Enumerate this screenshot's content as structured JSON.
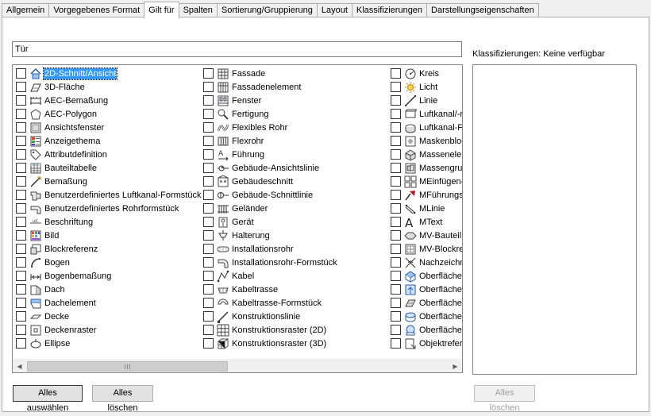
{
  "tabs": [
    {
      "label": "Allgemein",
      "active": false
    },
    {
      "label": "Vorgegebenes Format",
      "active": false
    },
    {
      "label": "Gilt für",
      "active": true
    },
    {
      "label": "Spalten",
      "active": false
    },
    {
      "label": "Sortierung/Gruppierung",
      "active": false
    },
    {
      "label": "Layout",
      "active": false
    },
    {
      "label": "Klassifizierungen",
      "active": false
    },
    {
      "label": "Darstellungseigenschaften",
      "active": false
    }
  ],
  "search": {
    "value": "Tür"
  },
  "columns": [
    [
      {
        "label": "2D-Schnitt/Ansicht",
        "icon": "house-section-icon",
        "selected": true
      },
      {
        "label": "3D-Fläche",
        "icon": "3d-face-icon"
      },
      {
        "label": "AEC-Bemaßung",
        "icon": "aec-dimension-icon"
      },
      {
        "label": "AEC-Polygon",
        "icon": "polygon-icon"
      },
      {
        "label": "Ansichtsfenster",
        "icon": "viewport-icon"
      },
      {
        "label": "Anzeigethema",
        "icon": "display-theme-icon"
      },
      {
        "label": "Attributdefinition",
        "icon": "tag-icon"
      },
      {
        "label": "Bauteiltabelle",
        "icon": "table-icon"
      },
      {
        "label": "Bemaßung",
        "icon": "dimension-icon"
      },
      {
        "label": "Benutzerdefiniertes Luftkanal-Formstück",
        "icon": "duct-fitting-icon"
      },
      {
        "label": "Benutzerdefiniertes Rohrformstück",
        "icon": "pipe-fitting-icon"
      },
      {
        "label": "Beschriftung",
        "icon": "annotation-icon"
      },
      {
        "label": "Bild",
        "icon": "image-icon"
      },
      {
        "label": "Blockreferenz",
        "icon": "block-reference-icon"
      },
      {
        "label": "Bogen",
        "icon": "arc-icon"
      },
      {
        "label": "Bogenbemaßung",
        "icon": "arc-dimension-icon"
      },
      {
        "label": "Dach",
        "icon": "roof-icon"
      },
      {
        "label": "Dachelement",
        "icon": "roof-slab-icon"
      },
      {
        "label": "Decke",
        "icon": "slab-icon"
      },
      {
        "label": "Deckenraster",
        "icon": "ceiling-grid-icon"
      },
      {
        "label": "Ellipse",
        "icon": "ellipse-icon"
      }
    ],
    [
      {
        "label": "Fassade",
        "icon": "curtain-wall-icon"
      },
      {
        "label": "Fassadenelement",
        "icon": "curtain-wall-unit-icon"
      },
      {
        "label": "Fenster",
        "icon": "window-icon"
      },
      {
        "label": "Fertigung",
        "icon": "fabrication-icon"
      },
      {
        "label": "Flexibles Rohr",
        "icon": "flex-pipe-icon"
      },
      {
        "label": "Flexrohr",
        "icon": "flex-duct-icon"
      },
      {
        "label": "Führung",
        "icon": "leader-icon"
      },
      {
        "label": "Gebäude-Ansichtslinie",
        "icon": "elevation-line-icon"
      },
      {
        "label": "Gebäudeschnitt",
        "icon": "building-section-icon"
      },
      {
        "label": "Gebäude-Schnittlinie",
        "icon": "section-line-icon"
      },
      {
        "label": "Geländer",
        "icon": "railing-icon"
      },
      {
        "label": "Gerät",
        "icon": "device-icon"
      },
      {
        "label": "Halterung",
        "icon": "hanger-icon"
      },
      {
        "label": "Installationsrohr",
        "icon": "conduit-icon"
      },
      {
        "label": "Installationsrohr-Formstück",
        "icon": "conduit-fitting-icon"
      },
      {
        "label": "Kabel",
        "icon": "wire-icon"
      },
      {
        "label": "Kabeltrasse",
        "icon": "cable-tray-icon"
      },
      {
        "label": "Kabeltrasse-Formstück",
        "icon": "cable-tray-fitting-icon"
      },
      {
        "label": "Konstruktionslinie",
        "icon": "construction-line-icon"
      },
      {
        "label": "Konstruktionsraster (2D)",
        "icon": "grid-2d-icon"
      },
      {
        "label": "Konstruktionsraster (3D)",
        "icon": "grid-3d-icon"
      }
    ],
    [
      {
        "label": "Kreis",
        "icon": "circle-icon"
      },
      {
        "label": "Licht",
        "icon": "light-icon"
      },
      {
        "label": "Linie",
        "icon": "line-icon"
      },
      {
        "label": "Luftkanal/-r",
        "icon": "duct-icon"
      },
      {
        "label": "Luftkanal-Fo",
        "icon": "duct-fitting-2-icon"
      },
      {
        "label": "Maskenbloc",
        "icon": "mask-block-icon"
      },
      {
        "label": "Massenelem",
        "icon": "mass-element-icon"
      },
      {
        "label": "Massengrup",
        "icon": "mass-group-icon"
      },
      {
        "label": "MEinfügen-",
        "icon": "minsert-icon"
      },
      {
        "label": "MFührungsli",
        "icon": "mleader-icon"
      },
      {
        "label": "MLinie",
        "icon": "mline-icon"
      },
      {
        "label": "MText",
        "icon": "mtext-icon"
      },
      {
        "label": "MV-Bauteil",
        "icon": "mv-part-icon"
      },
      {
        "label": "MV-Blockref",
        "icon": "mv-block-icon"
      },
      {
        "label": "Nachzeichn",
        "icon": "trace-icon"
      },
      {
        "label": "Oberfläche",
        "icon": "surface-icon"
      },
      {
        "label": "Oberfläche",
        "icon": "surface-2-icon"
      },
      {
        "label": "Oberfläche",
        "icon": "surface-3-icon"
      },
      {
        "label": "Oberfläche",
        "icon": "surface-4-icon"
      },
      {
        "label": "Oberfläche",
        "icon": "surface-5-icon"
      },
      {
        "label": "Objektrefere",
        "icon": "xref-icon"
      }
    ]
  ],
  "right": {
    "label": "Klassifizierungen: Keine verfügbar"
  },
  "buttons": {
    "select_all": "Alles auswählen",
    "clear_all": "Alles löschen",
    "clear_right": "Alles löschen"
  }
}
